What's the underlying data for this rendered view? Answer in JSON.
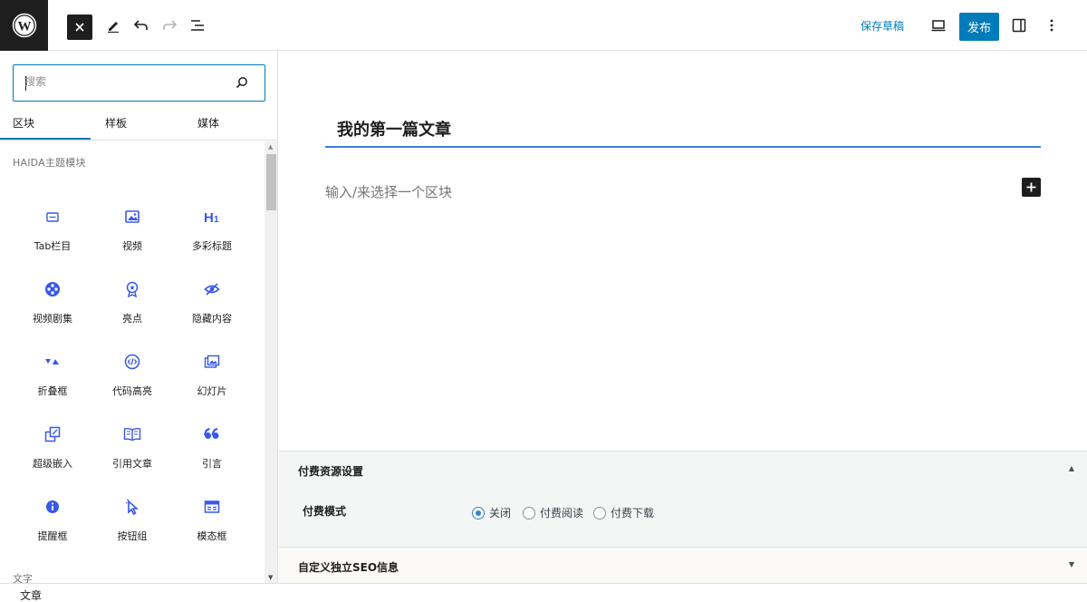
{
  "topbar": {
    "logo": "wordpress-logo",
    "save_draft": "保存草稿",
    "publish": "发布"
  },
  "sidebar": {
    "search": {
      "placeholder": "搜索",
      "value": ""
    },
    "tabs": [
      {
        "label": "区块",
        "active": true
      },
      {
        "label": "样板",
        "active": false
      },
      {
        "label": "媒体",
        "active": false
      }
    ],
    "section_title": "HAIDA主题模块",
    "blocks": [
      {
        "label": "Tab栏目",
        "icon": "tab-icon"
      },
      {
        "label": "视频",
        "icon": "video-icon"
      },
      {
        "label": "多彩标题",
        "icon": "heading-icon"
      },
      {
        "label": "视频剧集",
        "icon": "film-reel-icon"
      },
      {
        "label": "亮点",
        "icon": "award-icon"
      },
      {
        "label": "隐藏内容",
        "icon": "hidden-eye-icon"
      },
      {
        "label": "折叠框",
        "icon": "collapse-icon"
      },
      {
        "label": "代码高亮",
        "icon": "code-icon"
      },
      {
        "label": "幻灯片",
        "icon": "gallery-icon"
      },
      {
        "label": "超级嵌入",
        "icon": "embed-icon"
      },
      {
        "label": "引用文章",
        "icon": "book-icon"
      },
      {
        "label": "引言",
        "icon": "quote-icon"
      },
      {
        "label": "提醒框",
        "icon": "info-icon"
      },
      {
        "label": "按钮组",
        "icon": "pointer-icon"
      },
      {
        "label": "模态框",
        "icon": "modal-icon"
      }
    ],
    "next_category": "文字"
  },
  "editor": {
    "post_title": "我的第一篇文章",
    "block_placeholder": "输入/来选择一个区块"
  },
  "metaboxes": {
    "paid": {
      "title": "付费资源设置",
      "field_label": "付费模式",
      "options": [
        {
          "label": "关闭",
          "checked": true
        },
        {
          "label": "付费阅读",
          "checked": false
        },
        {
          "label": "付费下载",
          "checked": false
        }
      ]
    },
    "seo": {
      "title": "自定义独立SEO信息"
    }
  },
  "footer": {
    "breadcrumb": "文章"
  },
  "colors": {
    "accent": "#007cba",
    "dark": "#1e1e1e",
    "title_underline": "#3e80d6"
  }
}
